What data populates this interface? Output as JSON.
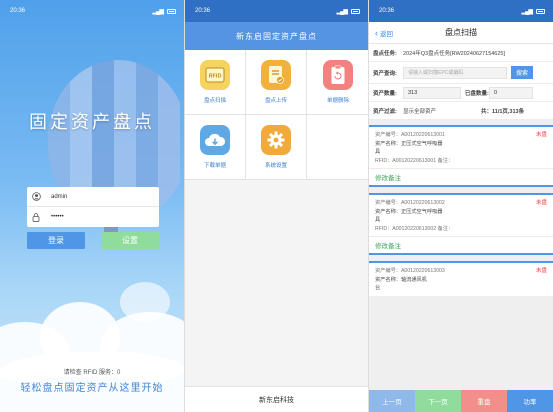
{
  "status_time": "20:36",
  "login": {
    "title": "固定资产盘点",
    "username": "admin",
    "password_masked": "••••••",
    "login_button": "登录",
    "settings_button": "设置",
    "rfid_status": "请检查 RFID 服务：0",
    "slogan": "轻松盘点固定资产从这里开始",
    "colors": {
      "login_button": "#4f96e6",
      "settings_button": "#8fdc9c"
    }
  },
  "menu": {
    "title": "新东启固定资产盘点",
    "items": [
      {
        "label": "盘点扫描",
        "icon": "rfid-card-icon",
        "color": "#f4d35e"
      },
      {
        "label": "盘点上传",
        "icon": "document-upload-icon",
        "color": "#f1b13d"
      },
      {
        "label": "单据删除",
        "icon": "clipboard-undo-icon",
        "color": "#f2817f"
      },
      {
        "label": "下载单据",
        "icon": "cloud-download-icon",
        "color": "#5ea8e6"
      },
      {
        "label": "系统设置",
        "icon": "gear-icon",
        "color": "#f0a93a"
      }
    ],
    "footer": "新东启科技"
  },
  "scan": {
    "back_label": "返回",
    "title": "盘点扫描",
    "task_label": "盘点任务:",
    "task_value": "2024年Q3盘点任务[RW20240627154625]",
    "query_label": "资产查询:",
    "query_placeholder": "请输入或扫描EPC或编码",
    "query_button": "搜索",
    "count_label": "资产数量:",
    "count_value": "313",
    "scanned_label": "已盘数量:",
    "scanned_value": "0",
    "filter_label": "资产过滤:",
    "filter_value": "显示全部资产",
    "page_info": "共：11/1页,313条",
    "assets": [
      {
        "code_line": "资产编号：A00120220613001",
        "name_line": "资产名称：正压式空气呼吸器",
        "name_cont": "具",
        "rfid_line": "RFID：A00120220613001    备注：",
        "status": "未盘",
        "remark": "修改备注"
      },
      {
        "code_line": "资产编号：A00120220613002",
        "name_line": "资产名称：正压式空气呼吸器",
        "name_cont": "具",
        "rfid_line": "RFID：A00120220613002    备注：",
        "status": "未盘",
        "remark": "修改备注"
      },
      {
        "code_line": "资产编号：A00120220613003",
        "name_line": "资产名称：轴流通风机",
        "name_cont": "台",
        "rfid_line": "",
        "status": "未盘",
        "remark": ""
      }
    ],
    "buttons": [
      {
        "label": "上一页",
        "color": "#8fb9ea"
      },
      {
        "label": "下一页",
        "color": "#8fdc9c"
      },
      {
        "label": "重盘",
        "color": "#f28f8a"
      },
      {
        "label": "功率",
        "color": "#4f96e6"
      }
    ]
  }
}
